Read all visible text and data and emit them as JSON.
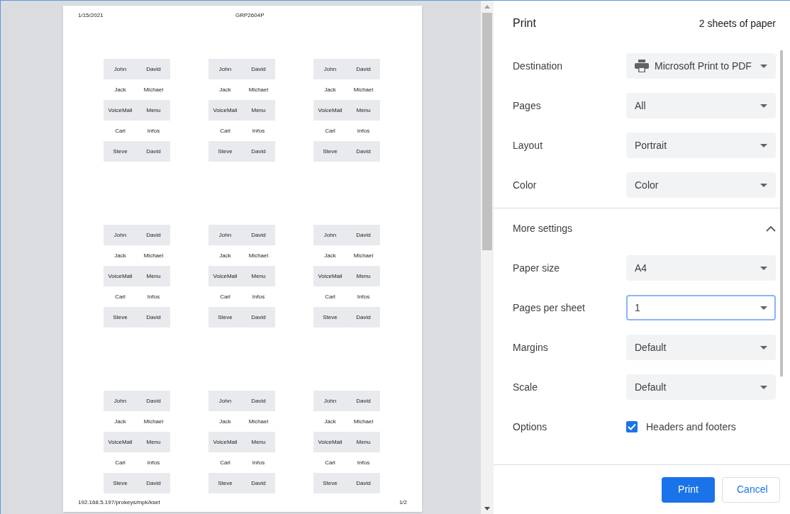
{
  "preview": {
    "header_left": "1/15/2021",
    "header_center": "GRP2604P",
    "cards": [
      {
        "rows": [
          {
            "cells": [
              "John",
              "David"
            ],
            "shaded": true
          },
          {
            "cells": [
              "Jack",
              "Michael"
            ],
            "shaded": false
          },
          {
            "cells": [
              "VoiceMail",
              "Menu"
            ],
            "shaded": true
          },
          {
            "cells": [
              "Carl",
              "Infos"
            ],
            "shaded": false
          },
          {
            "cells": [
              "Steve",
              "David"
            ],
            "shaded": true
          }
        ]
      },
      {
        "rows": [
          {
            "cells": [
              "John",
              "David"
            ],
            "shaded": true
          },
          {
            "cells": [
              "Jack",
              "Michael"
            ],
            "shaded": false
          },
          {
            "cells": [
              "VoiceMail",
              "Menu"
            ],
            "shaded": true
          },
          {
            "cells": [
              "Carl",
              "Infos"
            ],
            "shaded": false
          },
          {
            "cells": [
              "Steve",
              "David"
            ],
            "shaded": true
          }
        ]
      },
      {
        "rows": [
          {
            "cells": [
              "John",
              "David"
            ],
            "shaded": true
          },
          {
            "cells": [
              "Jack",
              "Michael"
            ],
            "shaded": false
          },
          {
            "cells": [
              "VoiceMail",
              "Menu"
            ],
            "shaded": true
          },
          {
            "cells": [
              "Carl",
              "Infos"
            ],
            "shaded": false
          },
          {
            "cells": [
              "Steve",
              "David"
            ],
            "shaded": true
          }
        ]
      },
      {
        "rows": [
          {
            "cells": [
              "John",
              "David"
            ],
            "shaded": true
          },
          {
            "cells": [
              "Jack",
              "Michael"
            ],
            "shaded": false
          },
          {
            "cells": [
              "VoiceMail",
              "Menu"
            ],
            "shaded": true
          },
          {
            "cells": [
              "Carl",
              "Infos"
            ],
            "shaded": false
          },
          {
            "cells": [
              "Steve",
              "David"
            ],
            "shaded": true
          }
        ]
      },
      {
        "rows": [
          {
            "cells": [
              "John",
              "David"
            ],
            "shaded": true
          },
          {
            "cells": [
              "Jack",
              "Michael"
            ],
            "shaded": false
          },
          {
            "cells": [
              "VoiceMail",
              "Menu"
            ],
            "shaded": true
          },
          {
            "cells": [
              "Carl",
              "Infos"
            ],
            "shaded": false
          },
          {
            "cells": [
              "Steve",
              "David"
            ],
            "shaded": true
          }
        ]
      },
      {
        "rows": [
          {
            "cells": [
              "John",
              "David"
            ],
            "shaded": true
          },
          {
            "cells": [
              "Jack",
              "Michael"
            ],
            "shaded": false
          },
          {
            "cells": [
              "VoiceMail",
              "Menu"
            ],
            "shaded": true
          },
          {
            "cells": [
              "Carl",
              "Infos"
            ],
            "shaded": false
          },
          {
            "cells": [
              "Steve",
              "David"
            ],
            "shaded": true
          }
        ]
      },
      {
        "rows": [
          {
            "cells": [
              "John",
              "David"
            ],
            "shaded": true
          },
          {
            "cells": [
              "Jack",
              "Michael"
            ],
            "shaded": false
          },
          {
            "cells": [
              "VoiceMail",
              "Menu"
            ],
            "shaded": true
          },
          {
            "cells": [
              "Carl",
              "Infos"
            ],
            "shaded": false
          },
          {
            "cells": [
              "Steve",
              "David"
            ],
            "shaded": true
          }
        ]
      },
      {
        "rows": [
          {
            "cells": [
              "John",
              "David"
            ],
            "shaded": true
          },
          {
            "cells": [
              "Jack",
              "Michael"
            ],
            "shaded": false
          },
          {
            "cells": [
              "VoiceMail",
              "Menu"
            ],
            "shaded": true
          },
          {
            "cells": [
              "Carl",
              "Infos"
            ],
            "shaded": false
          },
          {
            "cells": [
              "Steve",
              "David"
            ],
            "shaded": true
          }
        ]
      },
      {
        "rows": [
          {
            "cells": [
              "John",
              "David"
            ],
            "shaded": true
          },
          {
            "cells": [
              "Jack",
              "Michael"
            ],
            "shaded": false
          },
          {
            "cells": [
              "VoiceMail",
              "Menu"
            ],
            "shaded": true
          },
          {
            "cells": [
              "Carl",
              "Infos"
            ],
            "shaded": false
          },
          {
            "cells": [
              "Steve",
              "David"
            ],
            "shaded": true
          }
        ]
      }
    ],
    "footer_left": "192.168.5.197/prokeys/mpk/kset",
    "footer_right": "1/2"
  },
  "panel": {
    "title": "Print",
    "sheets": "2 sheets of paper",
    "settings": [
      {
        "label": "Destination",
        "value": "Microsoft Print to PDF",
        "kind": "printer",
        "focused": false
      },
      {
        "label": "Pages",
        "value": "All",
        "kind": "select",
        "focused": false
      },
      {
        "label": "Layout",
        "value": "Portrait",
        "kind": "select",
        "focused": false
      },
      {
        "label": "Color",
        "value": "Color",
        "kind": "select",
        "focused": false
      }
    ],
    "more_settings": {
      "label": "More settings",
      "expanded": true
    },
    "more": [
      {
        "label": "Paper size",
        "value": "A4",
        "kind": "select",
        "focused": false
      },
      {
        "label": "Pages per sheet",
        "value": "1",
        "kind": "select",
        "focused": true
      },
      {
        "label": "Margins",
        "value": "Default",
        "kind": "select",
        "focused": false
      },
      {
        "label": "Scale",
        "value": "Default",
        "kind": "select",
        "focused": false
      },
      {
        "label": "Options",
        "value": "Headers and footers",
        "kind": "checkbox",
        "checked": true
      }
    ],
    "buttons": [
      {
        "label": "Print",
        "primary": true
      },
      {
        "label": "Cancel",
        "primary": false
      }
    ]
  }
}
